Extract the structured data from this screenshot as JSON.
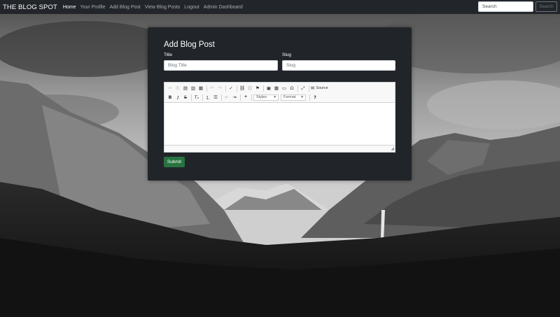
{
  "navbar": {
    "brand": "THE BLOG SPOT",
    "links": [
      {
        "label": "Home",
        "active": true
      },
      {
        "label": "Your Profile",
        "active": false
      },
      {
        "label": "Add Blog Post",
        "active": false
      },
      {
        "label": "View Blog Posts",
        "active": false
      },
      {
        "label": "Logout",
        "active": false
      },
      {
        "label": "Admin Dashboard",
        "active": false
      }
    ],
    "search_placeholder": "Search",
    "search_button": "Search"
  },
  "form": {
    "heading": "Add Blog Post",
    "title_label": "Title",
    "title_placeholder": "Blog Title",
    "slug_label": "Slug",
    "slug_placeholder": "Slug",
    "editor": {
      "styles_combo": "Styles",
      "format_combo": "Format",
      "source_label": "Source"
    },
    "submit_label": "Submit"
  },
  "colors": {
    "navbar_bg": "#222529",
    "card_bg": "#212529",
    "submit_bg": "#28733f"
  }
}
